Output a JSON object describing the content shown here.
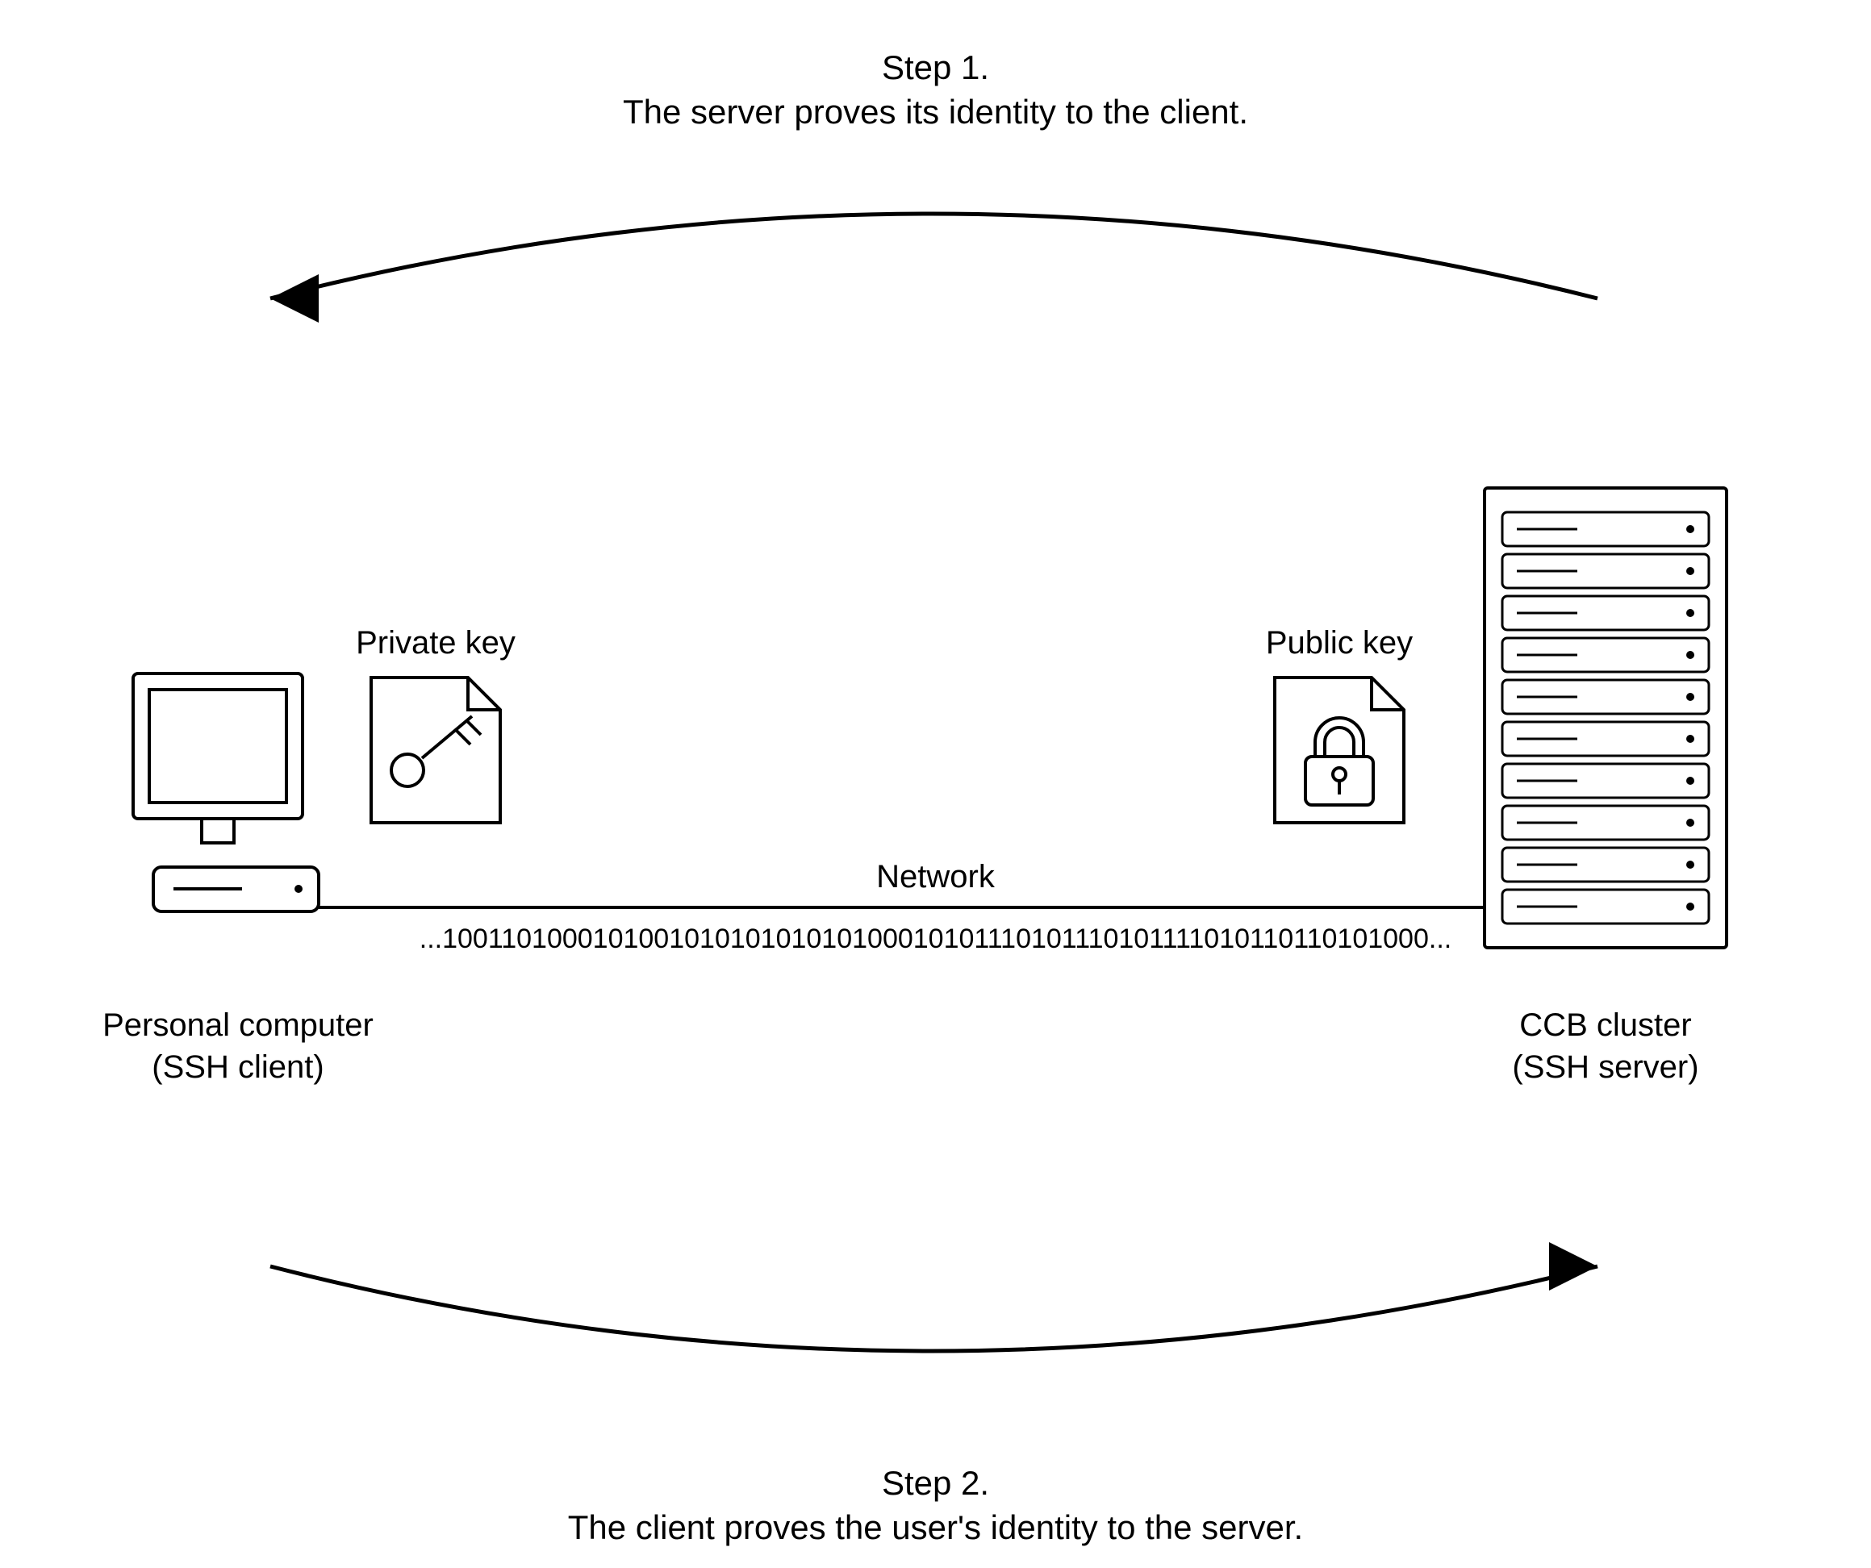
{
  "step1": {
    "title": "Step 1.",
    "text": "The server proves its identity to the client."
  },
  "step2": {
    "title": "Step 2.",
    "text": "The client proves the user's identity to the server."
  },
  "privateKey": {
    "label": "Private key"
  },
  "publicKey": {
    "label": "Public key"
  },
  "network": {
    "label": "Network",
    "bits": "...100110100010100101010101010100010101110101110101111010110110101000..."
  },
  "client": {
    "name": "Personal computer",
    "role": "(SSH client)"
  },
  "server": {
    "name": "CCB cluster",
    "role": "(SSH server)"
  }
}
